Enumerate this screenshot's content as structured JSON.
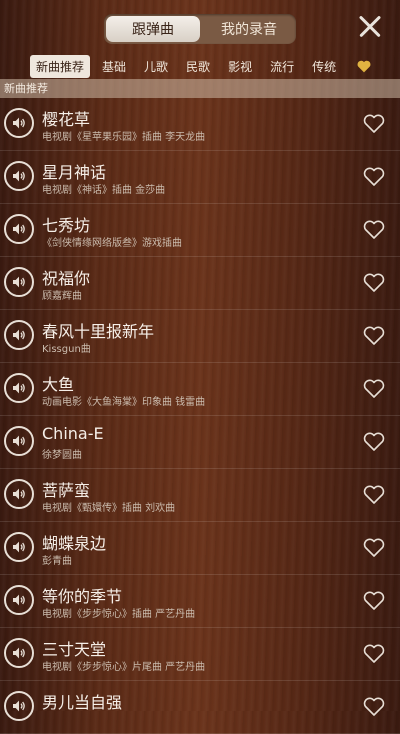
{
  "header": {
    "tabs": [
      {
        "label": "跟弹曲",
        "active": true
      },
      {
        "label": "我的录音",
        "active": false
      }
    ]
  },
  "categories": [
    {
      "label": "新曲推荐",
      "active": true
    },
    {
      "label": "基础"
    },
    {
      "label": "儿歌"
    },
    {
      "label": "民歌"
    },
    {
      "label": "影视"
    },
    {
      "label": "流行"
    },
    {
      "label": "传统"
    }
  ],
  "favorites_icon": "heart-icon",
  "accent_colors": {
    "favorites": "#e0b341",
    "text": "#f6efe8",
    "subtext": "#cbbcae"
  },
  "section": {
    "title": "新曲推荐"
  },
  "songs": [
    {
      "title": "樱花草",
      "subtitle": "电视剧《星苹果乐园》插曲 李天龙曲"
    },
    {
      "title": "星月神话",
      "subtitle": "电视剧《神话》插曲 金莎曲"
    },
    {
      "title": "七秀坊",
      "subtitle": "《剑侠情缘网络版叁》游戏插曲"
    },
    {
      "title": "祝福你",
      "subtitle": "顾嘉辉曲"
    },
    {
      "title": "春风十里报新年",
      "subtitle": "Kissgun曲"
    },
    {
      "title": "大鱼",
      "subtitle": "动画电影《大鱼海棠》印象曲 钱雷曲"
    },
    {
      "title": "China-E",
      "subtitle": "徐梦圆曲"
    },
    {
      "title": "菩萨蛮",
      "subtitle": "电视剧《甄嬛传》插曲 刘欢曲"
    },
    {
      "title": "蝴蝶泉边",
      "subtitle": "彭青曲"
    },
    {
      "title": "等你的季节",
      "subtitle": "电视剧《步步惊心》插曲 严艺丹曲"
    },
    {
      "title": "三寸天堂",
      "subtitle": "电视剧《步步惊心》片尾曲 严艺丹曲"
    },
    {
      "title": "男儿当自强",
      "subtitle": ""
    }
  ]
}
